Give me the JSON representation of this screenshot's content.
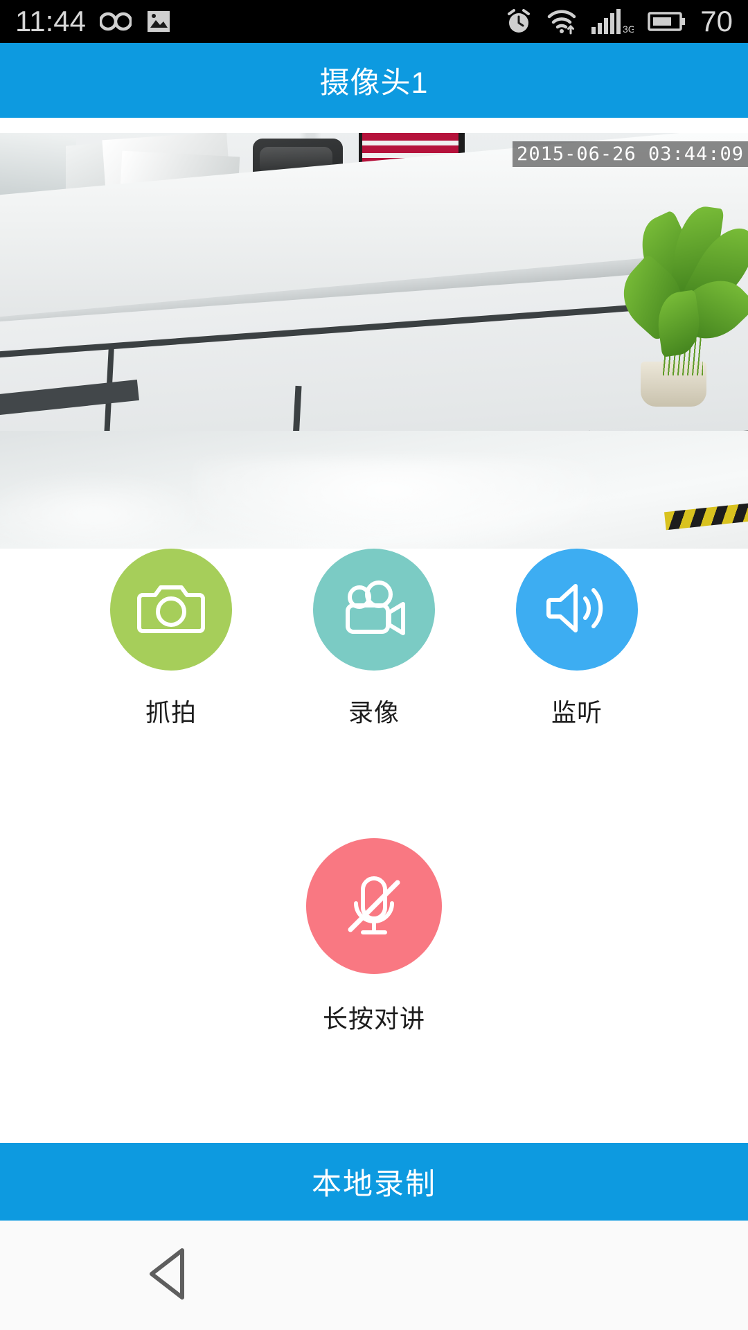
{
  "status_bar": {
    "time": "11:44",
    "battery_percent": "70",
    "network_type": "3G",
    "icons": [
      "infinity-icon",
      "image-icon",
      "alarm-clock-icon",
      "wifi-icon",
      "signal-bars-icon",
      "battery-icon"
    ]
  },
  "title_bar": {
    "title": "摄像头1",
    "background_color": "#0d9ae0",
    "text_color": "#ffffff"
  },
  "video": {
    "timestamp": "2015-06-26 03:44:09",
    "scene_description": "office reception counter"
  },
  "controls": {
    "buttons": [
      {
        "id": "snapshot",
        "label": "抓拍",
        "icon": "camera-icon",
        "color": "#a6ce5a"
      },
      {
        "id": "record",
        "label": "录像",
        "icon": "video-camera-icon",
        "color": "#7bcbc4"
      },
      {
        "id": "listen",
        "label": "监听",
        "icon": "speaker-icon",
        "color": "#3dadf2"
      },
      {
        "id": "talk",
        "label": "长按对讲",
        "icon": "mic-muted-icon",
        "color": "#f97882"
      }
    ]
  },
  "bottom_bar": {
    "label": "本地录制",
    "background_color": "#0d9ae0"
  },
  "nav_bar": {
    "back_label": "back-button",
    "background_color": "#fafafa"
  }
}
